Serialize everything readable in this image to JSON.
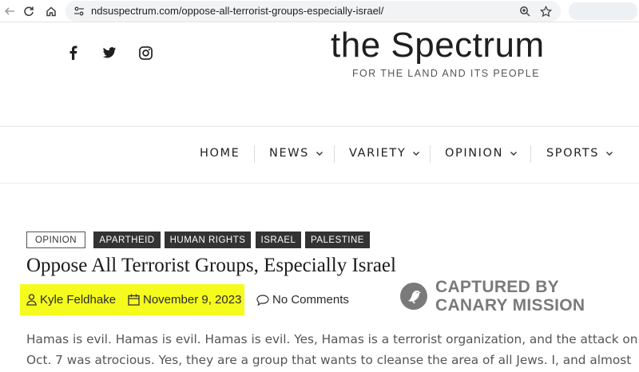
{
  "browser": {
    "url": "ndsuspectrum.com/oppose-all-terrorist-groups-especially-israel/",
    "icons": [
      "back-arrow-icon",
      "refresh-icon",
      "home-icon",
      "site-info-icon",
      "zoom-icon",
      "star-icon"
    ]
  },
  "site": {
    "title": "the Spectrum",
    "tagline": "FOR THE LAND AND ITS PEOPLE",
    "social": [
      "facebook-icon",
      "twitter-icon",
      "instagram-icon"
    ]
  },
  "nav": {
    "items": [
      {
        "label": "HOME",
        "dropdown": false
      },
      {
        "label": "NEWS",
        "dropdown": true
      },
      {
        "label": "VARIETY",
        "dropdown": true
      },
      {
        "label": "OPINION",
        "dropdown": true
      },
      {
        "label": "SPORTS",
        "dropdown": true
      }
    ]
  },
  "article": {
    "category": "OPINION",
    "tags": [
      "APARTHEID",
      "HUMAN RIGHTS",
      "ISRAEL",
      "PALESTINE"
    ],
    "title": "Oppose All Terrorist Groups, Especially Israel",
    "author": "Kyle Feldhake",
    "date": "November 9, 2023",
    "comments": "No Comments",
    "body_lines": [
      "Hamas is evil. Hamas is evil. Hamas is evil. Yes, Hamas is a terrorist organization, and the attack on",
      "Oct. 7 was atrocious. Yes, they are a group that wants to cleanse the area of all Jews. I, and almost"
    ]
  },
  "watermark": {
    "line1": "CAPTURED BY",
    "line2": "CANARY MISSION"
  },
  "colors": {
    "highlight": "#f5fb1c",
    "tag_dark": "#333333",
    "watermark": "#7a7a7a"
  }
}
